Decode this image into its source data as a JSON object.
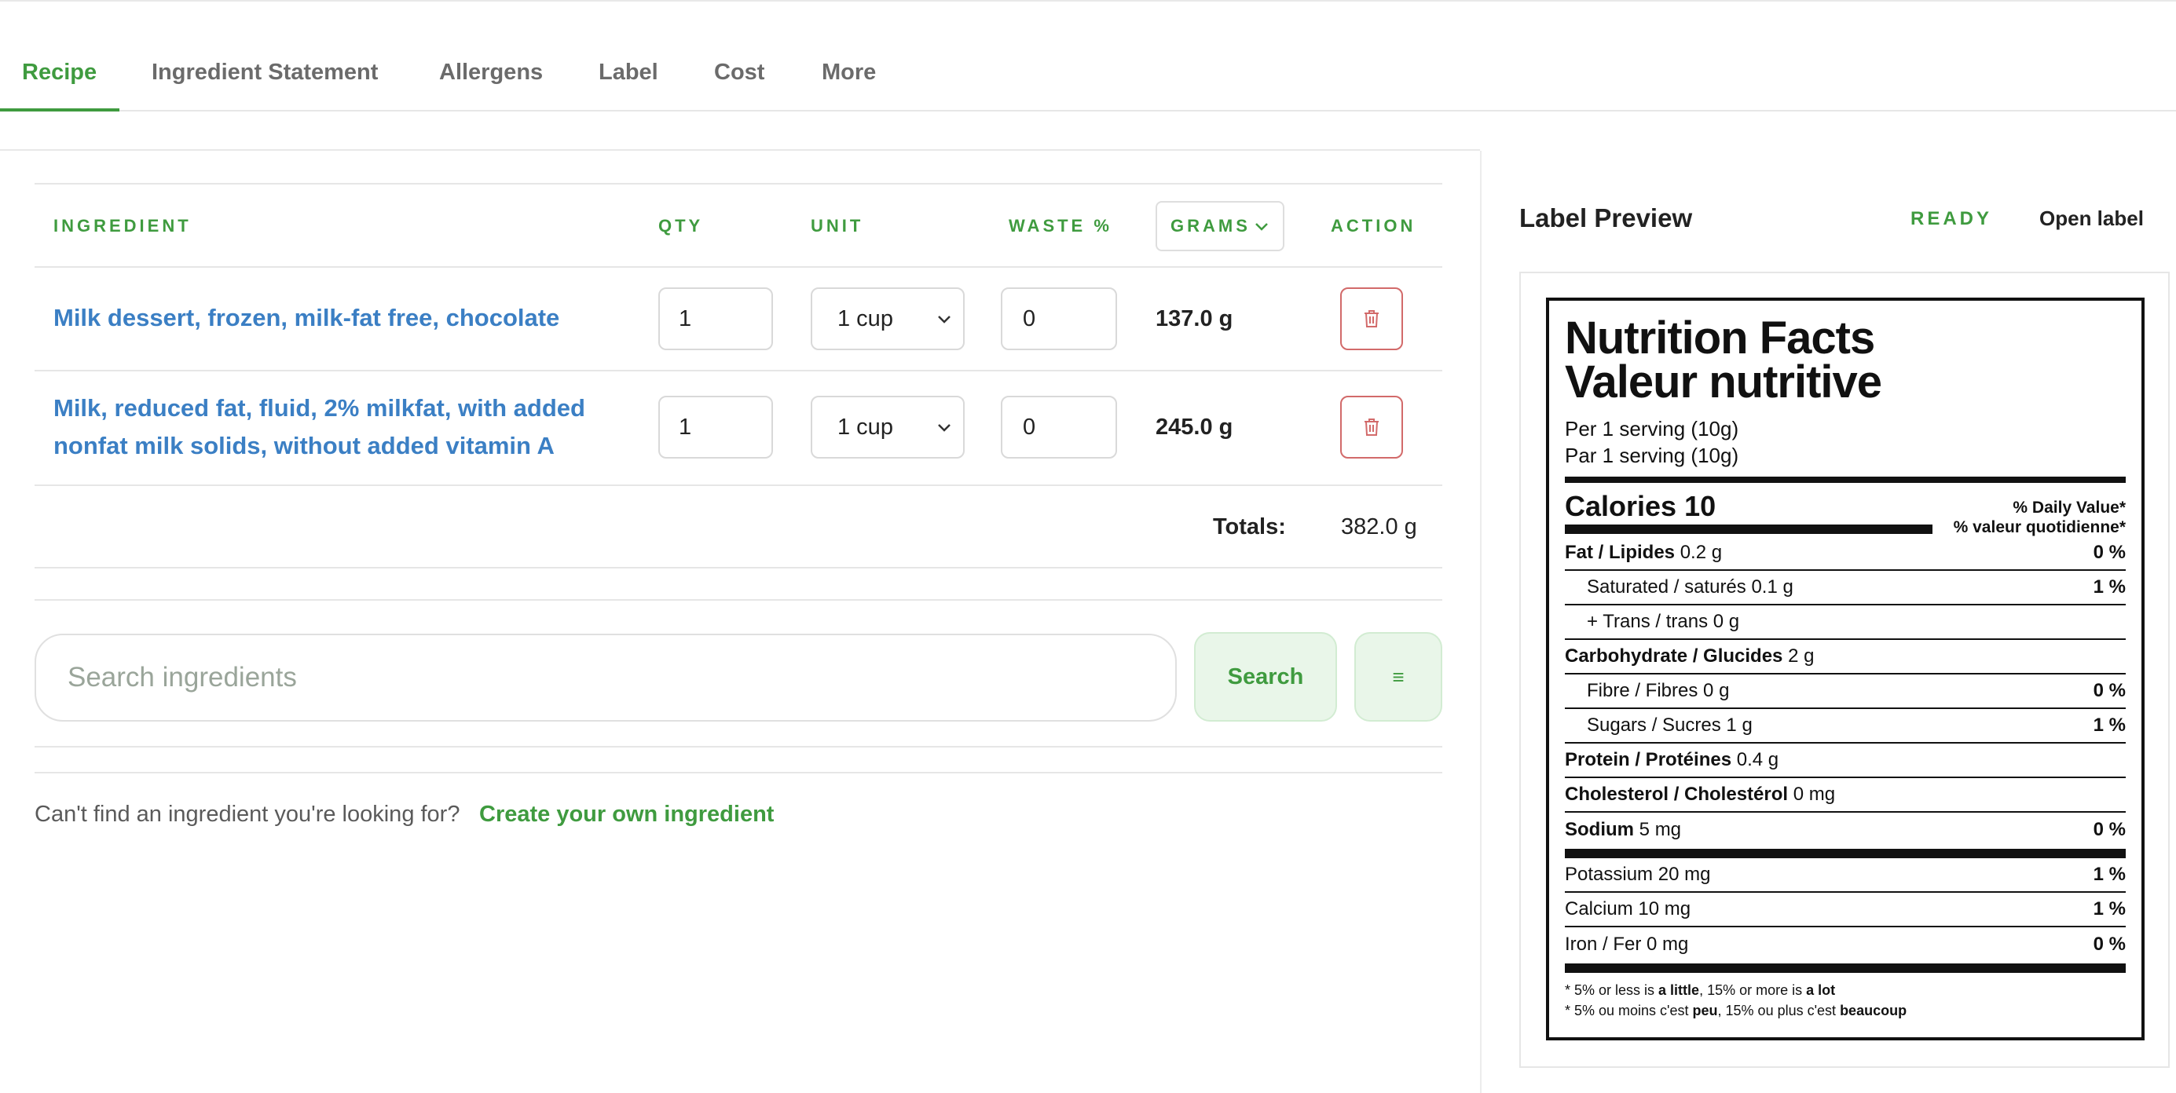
{
  "tabs": [
    {
      "label": "Recipe",
      "active": true
    },
    {
      "label": "Ingredient Statement"
    },
    {
      "label": "Allergens"
    },
    {
      "label": "Label"
    },
    {
      "label": "Cost"
    },
    {
      "label": "More"
    }
  ],
  "table": {
    "headers": {
      "ingredient": "INGREDIENT",
      "qty": "QTY",
      "unit": "UNIT",
      "waste": "WASTE %",
      "grams": "GRAMS",
      "action": "ACTION"
    },
    "rows": [
      {
        "name_line1": "Milk dessert, frozen, milk-fat free, chocolate",
        "name_line2": "",
        "qty": "1",
        "unit": "1 cup",
        "waste": "0",
        "grams": "137.0 g"
      },
      {
        "name_line1": "Milk, reduced fat, fluid, 2% milkfat, with added",
        "name_line2": "nonfat milk solids, without added vitamin A",
        "qty": "1",
        "unit": "1 cup",
        "waste": "0",
        "grams": "245.0 g"
      }
    ],
    "totals_label": "Totals:",
    "totals_value": "382.0 g"
  },
  "search": {
    "placeholder": "Search ingredients",
    "button": "Search",
    "filter_glyph": "≡"
  },
  "footer": {
    "cant_find": "Can't find an ingredient you're looking for?",
    "create_link": "Create your own ingredient"
  },
  "label_preview": {
    "title": "Label Preview",
    "status": "READY",
    "open_label": "Open label"
  },
  "nutrition": {
    "title_en": "Nutrition Facts",
    "title_fr": "Valeur nutritive",
    "serving_en": "Per 1 serving (10g)",
    "serving_fr": "Par 1 serving (10g)",
    "calories_label": "Calories 10",
    "dv_en": "% Daily Value*",
    "dv_fr": "% valeur quotidienne*",
    "rows": [
      {
        "label": "Fat / Lipides",
        "amount": "0.2 g",
        "pct": "0 %",
        "bold": true
      },
      {
        "label": "Saturated / saturés",
        "amount": "0.1 g",
        "pct": "1 %",
        "bold": false
      },
      {
        "label": "+ Trans / trans",
        "amount": "0 g",
        "pct": "",
        "bold": false
      },
      {
        "label": "Carbohydrate / Glucides",
        "amount": "2 g",
        "pct": "",
        "bold": true
      },
      {
        "label": "Fibre / Fibres",
        "amount": "0 g",
        "pct": "0 %",
        "bold": false
      },
      {
        "label": "Sugars / Sucres",
        "amount": "1 g",
        "pct": "1 %",
        "bold": false
      },
      {
        "label": "Protein / Protéines",
        "amount": "0.4 g",
        "pct": "",
        "bold": true
      },
      {
        "label": "Cholesterol / Cholestérol",
        "amount": "0 mg",
        "pct": "",
        "bold": true
      },
      {
        "label": "Sodium",
        "amount": "5 mg",
        "pct": "0 %",
        "bold": true
      },
      {
        "label": "Potassium",
        "amount": "20 mg",
        "pct": "1 %",
        "bold": false
      },
      {
        "label": "Calcium",
        "amount": "10 mg",
        "pct": "1 %",
        "bold": false
      },
      {
        "label": "Iron / Fer",
        "amount": "0 mg",
        "pct": "0 %",
        "bold": false
      }
    ],
    "foot_en_1": "* 5% or less is ",
    "foot_en_b1": "a little",
    "foot_en_2": ", 15% or more is ",
    "foot_en_b2": "a lot",
    "foot_fr_1": "* 5% ou moins c'est ",
    "foot_fr_b1": "peu",
    "foot_fr_2": ", 15% ou plus c'est ",
    "foot_fr_b2": "beaucoup"
  }
}
